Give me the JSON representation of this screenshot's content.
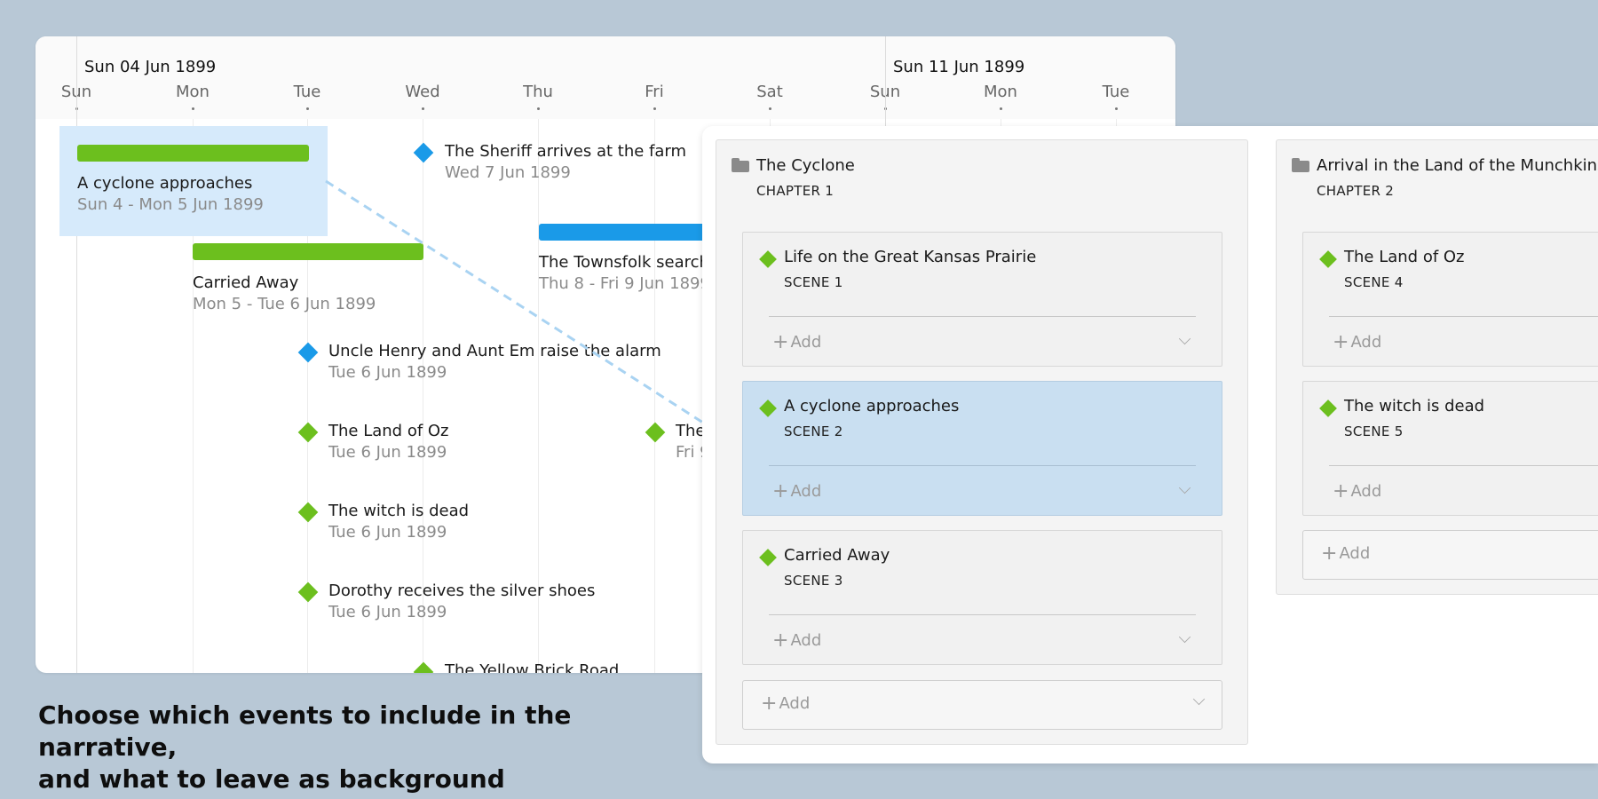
{
  "timeline": {
    "week_labels": [
      "Sun 04 Jun 1899",
      "Sun 11 Jun 1899"
    ],
    "days": [
      "Sun",
      "Mon",
      "Tue",
      "Wed",
      "Thu",
      "Fri",
      "Sat",
      "Sun",
      "Mon",
      "Tue"
    ],
    "events": [
      {
        "id": "cyclone",
        "kind": "range",
        "color": "green",
        "title": "A cyclone approaches",
        "date": "Sun 4 - Mon 5 Jun 1899",
        "selected": true
      },
      {
        "id": "sheriff",
        "kind": "point",
        "color": "blue",
        "title": "The Sheriff arrives at the farm",
        "date": "Wed 7 Jun 1899"
      },
      {
        "id": "townsfolk",
        "kind": "range",
        "color": "blue",
        "title": "The Townsfolk search",
        "date": "Thu 8 - Fri 9 Jun 1899"
      },
      {
        "id": "carried",
        "kind": "range",
        "color": "green",
        "title": "Carried Away",
        "date": "Mon 5 - Tue 6 Jun 1899"
      },
      {
        "id": "alarm",
        "kind": "point",
        "color": "blue",
        "title": "Uncle Henry and Aunt Em raise the alarm",
        "date": "Tue 6 Jun 1899"
      },
      {
        "id": "landofoz",
        "kind": "point",
        "color": "green",
        "title": "The Land of Oz",
        "date": "Tue 6 Jun 1899"
      },
      {
        "id": "fri-event",
        "kind": "point",
        "color": "green",
        "title": "The",
        "date": "Fri 9"
      },
      {
        "id": "witch",
        "kind": "point",
        "color": "green",
        "title": "The witch is dead",
        "date": "Tue 6 Jun 1899"
      },
      {
        "id": "shoes",
        "kind": "point",
        "color": "green",
        "title": "Dorothy receives the silver shoes",
        "date": "Tue 6 Jun 1899"
      },
      {
        "id": "yellow",
        "kind": "point",
        "color": "green",
        "title": "The Yellow Brick Road",
        "date": ""
      }
    ]
  },
  "caption": {
    "line1": "Choose which events to include in the narrative,",
    "line2": "and what to leave as background information."
  },
  "narrative": {
    "add_label": "Add",
    "chapters": [
      {
        "title": "The Cyclone",
        "subtitle": "CHAPTER 1",
        "scenes": [
          {
            "title": "Life on the Great Kansas Prairie",
            "subtitle": "SCENE 1",
            "selected": false
          },
          {
            "title": "A cyclone approaches",
            "subtitle": "SCENE 2",
            "selected": true
          },
          {
            "title": "Carried Away",
            "subtitle": "SCENE 3",
            "selected": false
          }
        ]
      },
      {
        "title": "Arrival in the Land of the Munchkins",
        "subtitle": "CHAPTER 2",
        "scenes": [
          {
            "title": "The Land of Oz",
            "subtitle": "SCENE 4",
            "selected": false
          },
          {
            "title": "The witch is dead",
            "subtitle": "SCENE 5",
            "selected": false
          }
        ]
      }
    ]
  },
  "colors": {
    "background": "#b8c8d6",
    "event_green": "#6cbf1e",
    "event_blue": "#1a9ae8",
    "selection": "#d6eafb",
    "scene_selected": "#c9dff1"
  }
}
